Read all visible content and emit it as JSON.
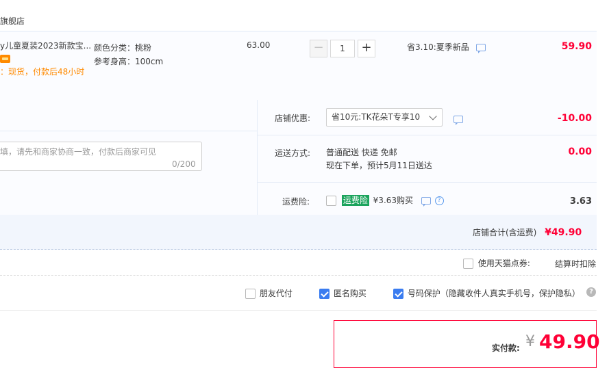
{
  "store": {
    "name": "旗舰店"
  },
  "item": {
    "title": "y儿童夏装2023新款宝...",
    "ship_note": "：现货，付款后48小时",
    "sku_color": "颜色分类：桃粉",
    "sku_height": "参考身高：100cm",
    "unit_price": "63.00",
    "quantity": "1",
    "minus": "−",
    "plus": "+",
    "promo": "省3.10:夏季新品",
    "subtotal": "59.90"
  },
  "message": {
    "placeholder": "填，请先和商家协商一致，付款后商家可见",
    "count": "0/200"
  },
  "store_discount": {
    "label": "店铺优惠:",
    "selected": "省10元:TK花朵T专享10",
    "amount": "-10.00"
  },
  "shipping": {
    "label": "运送方式:",
    "line1": "普通配送 快递 免邮",
    "line2": "现在下单，预计5月11日送达",
    "amount": "0.00"
  },
  "insurance": {
    "label": "运费险:",
    "tag": "运费险",
    "price": "¥3.63购买",
    "amount": "3.63",
    "checked": false
  },
  "store_total": {
    "label": "店铺合计(含运费)",
    "amount": "¥49.90"
  },
  "points": {
    "label": "使用天猫点券:",
    "note": "结算时扣除"
  },
  "options": [
    {
      "label": "朋友代付",
      "checked": false
    },
    {
      "label": "匿名购买",
      "checked": true
    },
    {
      "label": "号码保护（隐藏收件人真实手机号，保护隐私）",
      "checked": true
    }
  ],
  "help_glyph": "?",
  "payment": {
    "label": "实付款:",
    "currency": "¥",
    "amount": "49.90"
  },
  "colors": {
    "accent_red": "#ff0036",
    "blue": "#3a7cf0",
    "orange": "#ff8a00",
    "green": "#1aa35c"
  }
}
